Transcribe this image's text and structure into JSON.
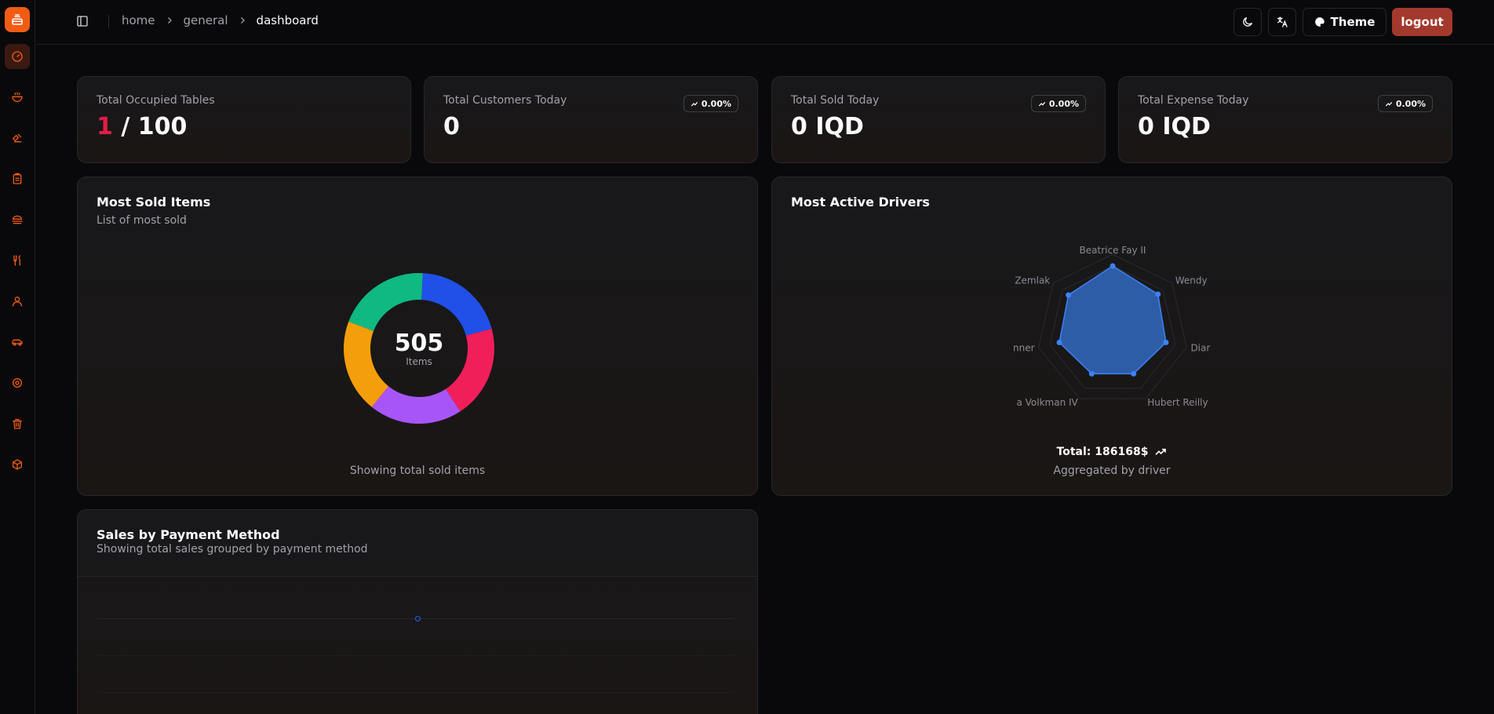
{
  "header": {
    "breadcrumb": [
      "home",
      "general",
      "dashboard"
    ],
    "theme_label": "Theme",
    "logout_label": "logout"
  },
  "sidebar": {
    "items": [
      "dashboard-icon",
      "bowl-icon",
      "chef-icon",
      "clipboard-icon",
      "burger-icon",
      "utensils-icon",
      "user-icon",
      "car-icon",
      "settings-icon",
      "trash-icon",
      "box-icon"
    ]
  },
  "stats": [
    {
      "label": "Total Occupied Tables",
      "value_highlight": "1",
      "value_rest": " / 100"
    },
    {
      "label": "Total Customers Today",
      "value": "0",
      "badge": "0.00%"
    },
    {
      "label": "Total Sold Today",
      "value": "0 IQD",
      "badge": "0.00%"
    },
    {
      "label": "Total Expense Today",
      "value": "0 IQD",
      "badge": "0.00%"
    }
  ],
  "most_sold": {
    "title": "Most Sold Items",
    "subtitle": "List of most sold",
    "total": "505",
    "unit": "Items",
    "footer": "Showing total sold items"
  },
  "drivers": {
    "title": "Most Active Drivers",
    "total": "Total: 186168$",
    "footer": "Aggregated by driver"
  },
  "payment": {
    "title": "Sales by Payment Method",
    "subtitle": "Showing total sales grouped by payment method"
  },
  "chart_data": [
    {
      "type": "pie",
      "center_label": "505 Items",
      "values": [
        101,
        101,
        101,
        101,
        101
      ],
      "colors": [
        "#2050e8",
        "#f01f5a",
        "#a855f7",
        "#f59e0b",
        "#10b981"
      ]
    },
    {
      "type": "radar",
      "categories": [
        "Beatrice Fay II",
        "Wendy",
        "Diar",
        "Hubert Reilly I",
        "a Volkman IV",
        "nner",
        "Zemlak"
      ],
      "series": [
        {
          "values": [
            100,
            90,
            85,
            75,
            75,
            85,
            88
          ]
        }
      ],
      "color": "#3b82f6"
    }
  ]
}
